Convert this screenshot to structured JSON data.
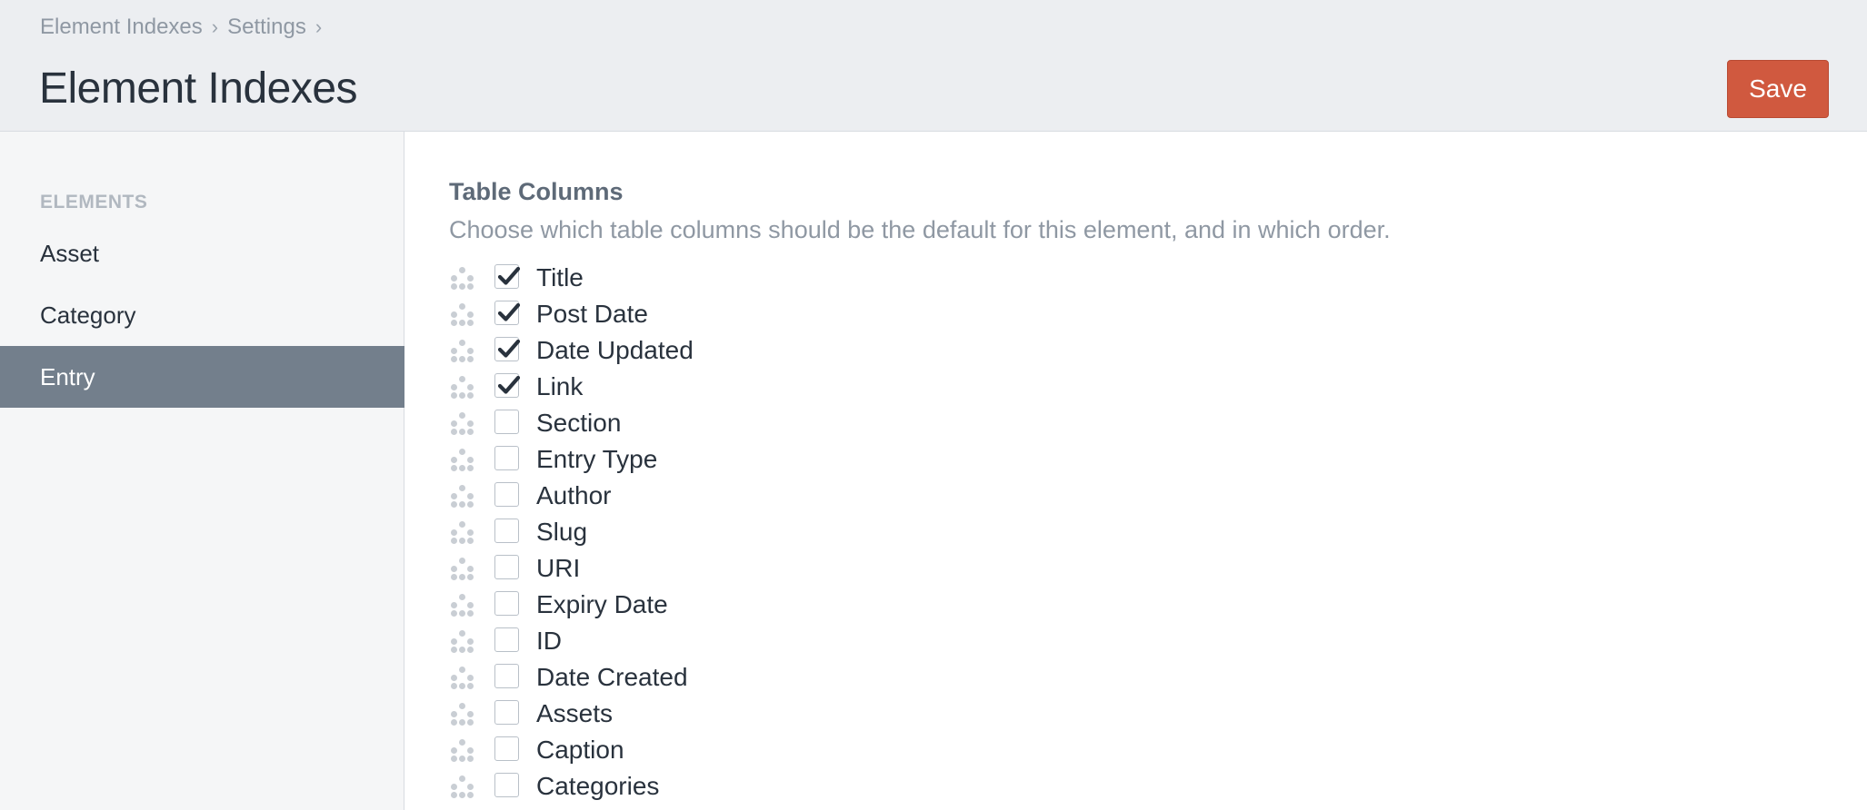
{
  "breadcrumb": [
    {
      "label": "Element Indexes"
    },
    {
      "label": "Settings"
    }
  ],
  "breadcrumb_separator": "›",
  "page_title": "Element Indexes",
  "save_label": "Save",
  "colors": {
    "accent": "#d0593f",
    "sidebar_active": "#737f8c",
    "header_bg": "#eceef1"
  },
  "sidebar": {
    "heading": "ELEMENTS",
    "items": [
      {
        "label": "Asset",
        "active": false
      },
      {
        "label": "Category",
        "active": false
      },
      {
        "label": "Entry",
        "active": true
      }
    ]
  },
  "table_columns": {
    "title": "Table Columns",
    "description": "Choose which table columns should be the default for this element, and in which order.",
    "columns": [
      {
        "label": "Title",
        "checked": true
      },
      {
        "label": "Post Date",
        "checked": true
      },
      {
        "label": "Date Updated",
        "checked": true
      },
      {
        "label": "Link",
        "checked": true
      },
      {
        "label": "Section",
        "checked": false
      },
      {
        "label": "Entry Type",
        "checked": false
      },
      {
        "label": "Author",
        "checked": false
      },
      {
        "label": "Slug",
        "checked": false
      },
      {
        "label": "URI",
        "checked": false
      },
      {
        "label": "Expiry Date",
        "checked": false
      },
      {
        "label": "ID",
        "checked": false
      },
      {
        "label": "Date Created",
        "checked": false
      },
      {
        "label": "Assets",
        "checked": false
      },
      {
        "label": "Caption",
        "checked": false
      },
      {
        "label": "Categories",
        "checked": false
      }
    ]
  }
}
